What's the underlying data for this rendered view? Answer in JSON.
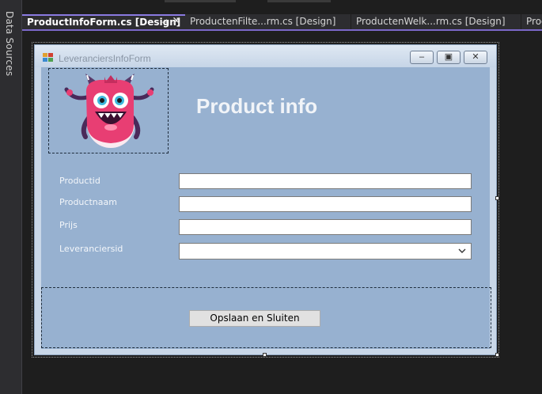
{
  "sidebar": {
    "data_sources_tab": "Data Sources"
  },
  "tabs": [
    {
      "label": "ProductInfoForm.cs [Design]",
      "active": true
    },
    {
      "label": "ProductenFilte...rm.cs [Design]",
      "active": false
    },
    {
      "label": "ProductenWelk...rm.cs [Design]",
      "active": false
    },
    {
      "label": "Proc",
      "active": false
    }
  ],
  "tab_icons": {
    "pin": "pin-icon",
    "close": "close-icon"
  },
  "form": {
    "title": "LeveranciersInfoForm",
    "heading": "Product info",
    "fields": [
      {
        "label": "Productid",
        "value": ""
      },
      {
        "label": "Productnaam",
        "value": ""
      },
      {
        "label": "Prijs",
        "value": ""
      },
      {
        "label": "Leveranciersid",
        "value": ""
      }
    ],
    "save_button": "Opslaan en Sluiten",
    "title_buttons": {
      "minimize": "minimize-icon",
      "restore": "restore-icon",
      "close": "close-icon"
    }
  },
  "colors": {
    "ide_background": "#1e1e1e",
    "tab_accent": "#7b68c8",
    "form_background": "#97b1d0",
    "mascot_body": "#e83e73"
  }
}
